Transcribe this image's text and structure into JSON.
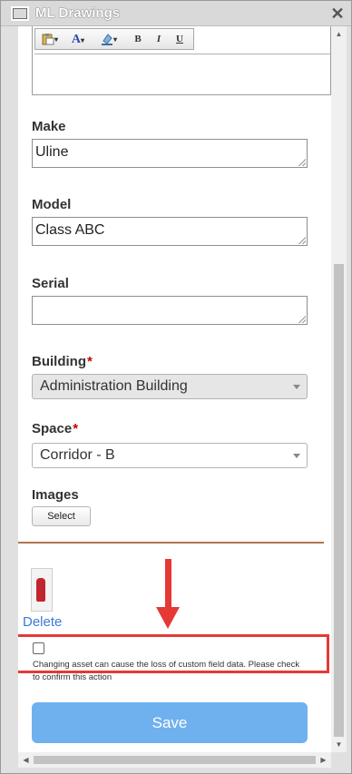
{
  "window": {
    "title": "ML Drawings",
    "close_label": "✕"
  },
  "editor_toolbar": {
    "paste_icon": "paste-icon",
    "font_color_label": "A",
    "highlight_icon": "highlight-icon",
    "bold_label": "B",
    "italic_label": "I",
    "underline_label": "U",
    "dropdown_glyph": "▾"
  },
  "fields": {
    "make": {
      "label": "Make",
      "value": "Uline"
    },
    "model": {
      "label": "Model",
      "value": "Class ABC"
    },
    "serial": {
      "label": "Serial",
      "value": ""
    },
    "building": {
      "label": "Building",
      "required_mark": "*",
      "value": "Administration Building",
      "disabled": true
    },
    "space": {
      "label": "Space",
      "required_mark": "*",
      "value": "Corridor - B",
      "disabled": false
    }
  },
  "images": {
    "label": "Images",
    "select_button": "Select",
    "delete_link": "Delete"
  },
  "confirm": {
    "checked": false,
    "text": "Changing asset can cause the loss of custom field data. Please check to confirm this action"
  },
  "save_button": "Save",
  "colors": {
    "accent_save": "#6fb1ee",
    "highlight_red": "#e53935",
    "divider_brown": "#b0744f",
    "required_red": "#c00000",
    "link_blue": "#3a7bd5"
  }
}
